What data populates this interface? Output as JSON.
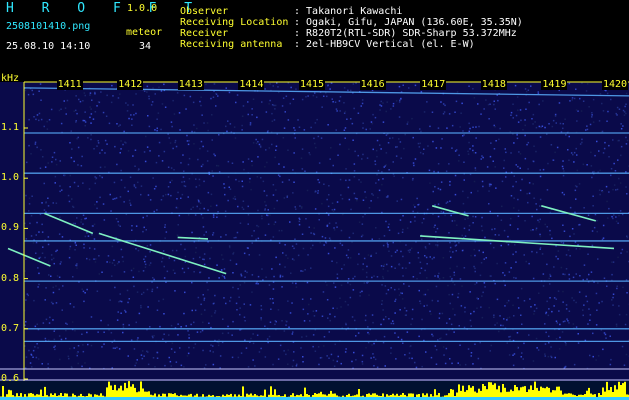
{
  "app": {
    "logo": "H R O F F T",
    "version": "1.0.0",
    "filename": "2508101410.png",
    "datetime": "25.08.10 14:10",
    "meteor_label": "meteor",
    "meteor_count": "34"
  },
  "info": {
    "labels": [
      "Observer",
      "Receiving Location",
      "Receiver",
      "Receiving antenna"
    ],
    "values": [
      ": Takanori Kawachi",
      ": Ogaki, Gifu, JAPAN (136.60E, 35.35N)",
      ": R820T2(RTL-SDR) SDR-Sharp 53.372MHz",
      ": 2el-HB9CV Vertical (el. E-W)"
    ]
  },
  "chart_data": {
    "type": "heatmap",
    "ylabel": "kHz",
    "y_ticks": [
      "1.1",
      "1.0",
      "0.9",
      "0.8",
      "0.7",
      "0.6"
    ],
    "x_ticks": [
      "1411",
      "1412",
      "1413",
      "1414",
      "1415",
      "1416",
      "1417",
      "1418",
      "1419",
      "1420"
    ],
    "ylim": [
      0.6,
      1.2
    ],
    "xlim": [
      1410,
      1420
    ],
    "background_color": "#0a0a4a",
    "axis_color": "#ffff30",
    "carrier_lines_khz": [
      1.18,
      1.09,
      1.01,
      0.93,
      0.875,
      0.795,
      0.7,
      0.675
    ],
    "meteor_traces": [
      {
        "x": [
          1410.0,
          1410.7
        ],
        "y": [
          0.86,
          0.825
        ]
      },
      {
        "x": [
          1410.6,
          1411.4
        ],
        "y": [
          0.93,
          0.89
        ]
      },
      {
        "x": [
          1411.5,
          1413.6
        ],
        "y": [
          0.89,
          0.81
        ]
      },
      {
        "x": [
          1412.8,
          1413.3
        ],
        "y": [
          0.882,
          0.879
        ]
      },
      {
        "x": [
          1417.0,
          1417.6
        ],
        "y": [
          0.945,
          0.925
        ]
      },
      {
        "x": [
          1418.8,
          1419.7
        ],
        "y": [
          0.945,
          0.915
        ]
      },
      {
        "x": [
          1416.8,
          1420.0
        ],
        "y": [
          0.885,
          0.86
        ]
      }
    ],
    "signal_strip_color": "#ffff00"
  }
}
